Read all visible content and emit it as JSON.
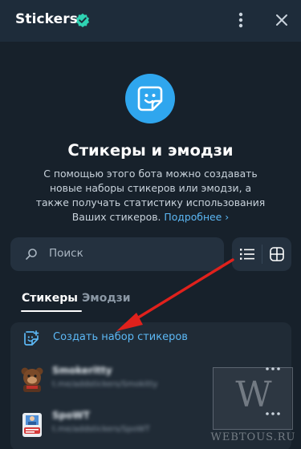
{
  "header": {
    "title": "Stickers",
    "verified_icon": "verified-badge-icon",
    "menu_icon": "more-vertical-icon",
    "close_icon": "close-icon"
  },
  "hero": {
    "icon": "sticker-icon",
    "title": "Стикеры и эмодзи",
    "description": "С помощью этого бота можно создавать новые наборы стикеров или эмодзи, а также получать статистику использования Ваших стикеров.",
    "more_link": "Подробнее ›"
  },
  "search": {
    "placeholder": "Поиск",
    "icon": "search-icon"
  },
  "view_toggle": {
    "list_icon": "list-view-icon",
    "grid_icon": "grid-view-icon",
    "selected": "list"
  },
  "tabs": [
    {
      "label": "Стикеры",
      "active": true
    },
    {
      "label": "Эмодзи",
      "active": false
    }
  ],
  "list": {
    "create_label": "Создать набор стикеров",
    "create_icon": "add-sticker-icon",
    "items": [
      {
        "name": "Smokeritty",
        "link": "t.me/addstickers/Smokitty",
        "thumb": "bear-sticker-icon"
      },
      {
        "name": "SpoWT",
        "link": "t.me/addstickers/SpoWT",
        "thumb": "person-sticker-icon"
      }
    ]
  },
  "watermark": {
    "letter": "W",
    "text": "WEBTOUS.RU"
  },
  "colors": {
    "header_bg": "#1e2c3a",
    "panel_bg": "#17212b",
    "accent": "#2fa6ee",
    "link": "#5cb8f5",
    "arrow": "#e0211c"
  }
}
